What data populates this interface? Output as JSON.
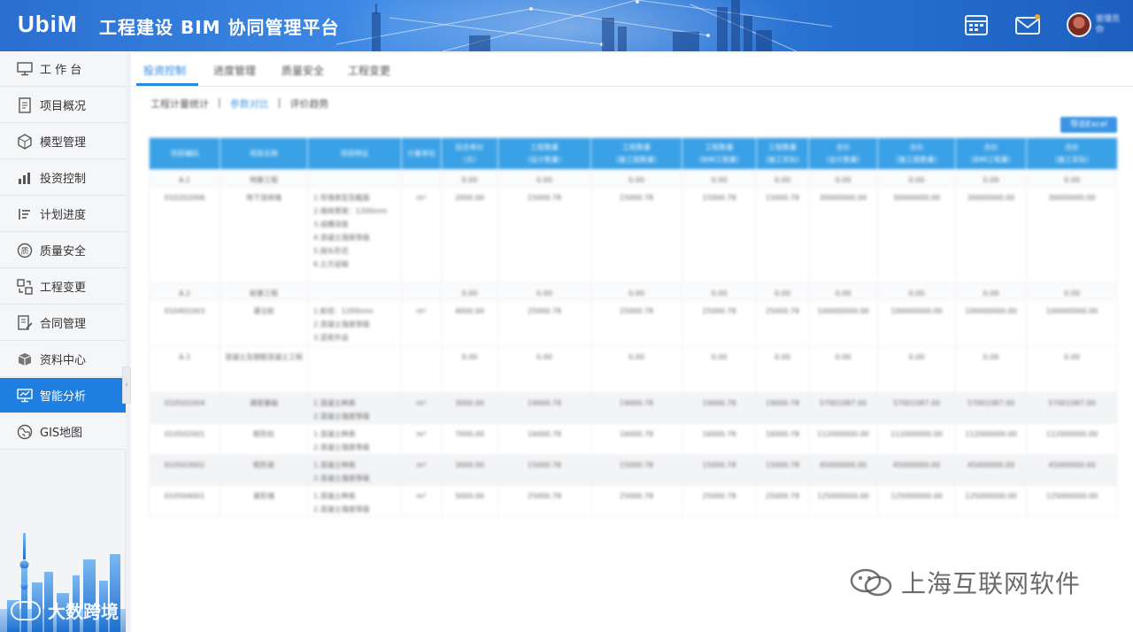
{
  "header": {
    "logo": "UbiM",
    "title": "工程建设 BIM 协同管理平台",
    "user": {
      "name_line1": "管理员",
      "name_line2": "你"
    }
  },
  "sidebar": {
    "items": [
      {
        "label": "工 作 台",
        "icon": "monitor-icon"
      },
      {
        "label": "项目概况",
        "icon": "document-icon"
      },
      {
        "label": "模型管理",
        "icon": "cube-icon"
      },
      {
        "label": "投资控制",
        "icon": "bar-chart-icon"
      },
      {
        "label": "计划进度",
        "icon": "list-icon"
      },
      {
        "label": "质量安全",
        "icon": "quality-icon"
      },
      {
        "label": "工程变更",
        "icon": "change-icon"
      },
      {
        "label": "合同管理",
        "icon": "edit-document-icon"
      },
      {
        "label": "资料中心",
        "icon": "box-icon"
      },
      {
        "label": "智能分析",
        "icon": "analysis-monitor-icon",
        "active": true
      },
      {
        "label": "GIS地图",
        "icon": "globe-icon"
      }
    ],
    "watermark": "大数跨境",
    "collapse_glyph": "‹"
  },
  "main": {
    "tabs": [
      {
        "label": "投资控制",
        "active": true
      },
      {
        "label": "进度管理"
      },
      {
        "label": "质量安全"
      },
      {
        "label": "工程变更"
      }
    ],
    "breadcrumb": {
      "items": [
        "工程计量统计",
        "参数对比",
        "评价趋势"
      ],
      "separator": "|",
      "selected_index": 1
    },
    "export_label": "导出Excel",
    "table": {
      "headers": [
        "项目编码",
        "项目名称",
        "项目特征",
        "计量单位",
        "综合单价\n（元）",
        "工程数量\n（设计数量）",
        "工程数量\n（施工图数量）",
        "工程数量\n（BIM工程量）",
        "工程数量\n（施工实际）",
        "合价\n（设计数量）",
        "合价\n（施工图数量）",
        "合价\n（BIM工程量）",
        "合价\n（施工实际）"
      ],
      "rows": [
        {
          "kind": "sum",
          "cells": [
            "A.1",
            "地基工程",
            "",
            "",
            "0.00",
            "0.00",
            "0.00",
            "0.00",
            "0.00",
            "0.00",
            "0.00",
            "0.00",
            "0.00"
          ]
        },
        {
          "kind": "tall",
          "cells": [
            "010202006",
            "地下连续墙",
            "1.导墙类型及截面\n2.墙体厚度：1200mm\n3.成槽深度\n4.混凝土强度等级\n5.接头形式\n6.土方运输",
            "m³",
            "2000.00",
            "15000.78",
            "15000.78",
            "15000.78",
            "15000.78",
            "30000000.00",
            "30000000.00",
            "30000000.00",
            "30000000.00"
          ]
        },
        {
          "kind": "sum",
          "cells": [
            "A.2",
            "桩基工程",
            "",
            "",
            "0.00",
            "0.00",
            "0.00",
            "0.00",
            "0.00",
            "0.00",
            "0.00",
            "0.00",
            "0.00"
          ]
        },
        {
          "kind": "mid",
          "cells": [
            "010401003",
            "灌注桩",
            "1.桩径：1200mm\n2.混凝土强度等级\n3.泥浆外运",
            "m³",
            "4000.00",
            "25000.78",
            "25000.78",
            "25000.78",
            "25000.78",
            "100000000.00",
            "100000000.00",
            "100000000.00",
            "100000000.00"
          ]
        },
        {
          "kind": "mid",
          "cells": [
            "A.3",
            "混凝土及钢筋混凝土工程",
            "",
            "",
            "0.00",
            "0.00",
            "0.00",
            "0.00",
            "0.00",
            "0.00",
            "0.00",
            "0.00",
            "0.00"
          ]
        },
        {
          "kind": "mid2 grey",
          "cells": [
            "010501004",
            "满堂基础",
            "1.混凝土种类\n2.混凝土强度等级",
            "m³",
            "3000.00",
            "19000.78",
            "19000.78",
            "19000.78",
            "19000.78",
            "57001087.00",
            "57001087.00",
            "57001087.00",
            "57001087.00"
          ]
        },
        {
          "kind": "mid2",
          "cells": [
            "010502001",
            "矩形柱",
            "1.混凝土种类\n2.混凝土强度等级",
            "m³",
            "7000.00",
            "16000.78",
            "16000.78",
            "16000.78",
            "16000.78",
            "112000000.00",
            "112000000.00",
            "112000000.00",
            "112000000.00"
          ]
        },
        {
          "kind": "mid2 grey",
          "cells": [
            "010503002",
            "矩形梁",
            "1.混凝土种类\n2.混凝土强度等级",
            "m³",
            "3000.00",
            "15000.78",
            "15000.78",
            "15000.78",
            "15000.78",
            "45000000.00",
            "45000000.00",
            "45000000.00",
            "45000000.00"
          ]
        },
        {
          "kind": "mid2",
          "cells": [
            "010504001",
            "直形墙",
            "1.混凝土种类\n2.混凝土强度等级",
            "m³",
            "5000.00",
            "25000.78",
            "25000.78",
            "25000.78",
            "25000.78",
            "125000000.00",
            "125000000.00",
            "125000000.00",
            "125000000.00"
          ]
        }
      ]
    },
    "watermark": "上海互联网软件"
  },
  "colors": {
    "accent": "#1f7fe0",
    "header_blue": "#2d79d9",
    "table_header": "#3aa1e6"
  }
}
